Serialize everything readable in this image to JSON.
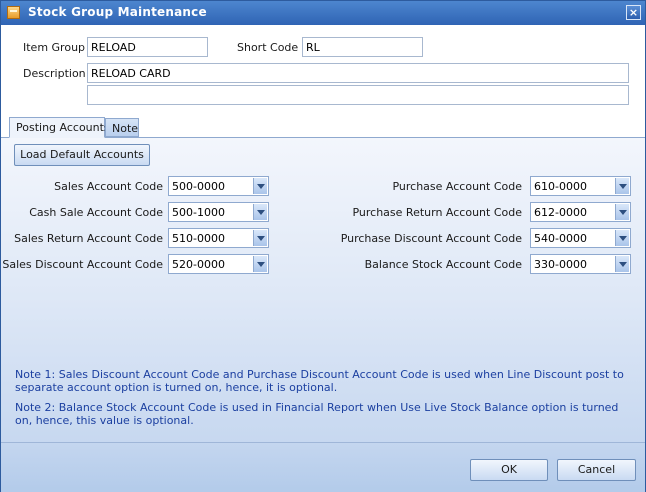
{
  "window": {
    "title": "Stock Group Maintenance",
    "close_glyph": "×"
  },
  "header": {
    "item_group_label": "Item Group",
    "item_group_value": "RELOAD",
    "short_code_label": "Short Code",
    "short_code_value": "RL",
    "description_label": "Description",
    "description_value": "RELOAD CARD",
    "description2_value": ""
  },
  "tabs": [
    {
      "label": "Posting Accounts",
      "active": true
    },
    {
      "label": "Note",
      "active": false
    }
  ],
  "posting": {
    "load_default_label": "Load Default Accounts",
    "left": [
      {
        "label": "Sales Account Code",
        "value": "500-0000"
      },
      {
        "label": "Cash Sale Account Code",
        "value": "500-1000"
      },
      {
        "label": "Sales Return Account Code",
        "value": "510-0000"
      },
      {
        "label": "Sales Discount Account Code",
        "value": "520-0000"
      }
    ],
    "right": [
      {
        "label": "Purchase Account Code",
        "value": "610-0000"
      },
      {
        "label": "Purchase Return Account Code",
        "value": "612-0000"
      },
      {
        "label": "Purchase Discount Account Code",
        "value": "540-0000"
      },
      {
        "label": "Balance Stock Account Code",
        "value": "330-0000"
      }
    ],
    "notes": [
      "Note 1: Sales Discount Account Code and Purchase Discount Account Code is used when Line Discount post to separate account option is turned on, hence, it is optional.",
      "Note 2: Balance Stock Account Code is used in Financial Report when Use Live Stock Balance option is turned on, hence, this value is optional."
    ]
  },
  "footer": {
    "ok_label": "OK",
    "cancel_label": "Cancel"
  },
  "colors": {
    "title_bar": "#2f64b4",
    "note_text": "#1b3fa0",
    "panel_bg": "#dde7f6"
  },
  "icons": {
    "title": "document-icon",
    "close": "close-icon",
    "dropdown": "chevron-down-icon"
  }
}
